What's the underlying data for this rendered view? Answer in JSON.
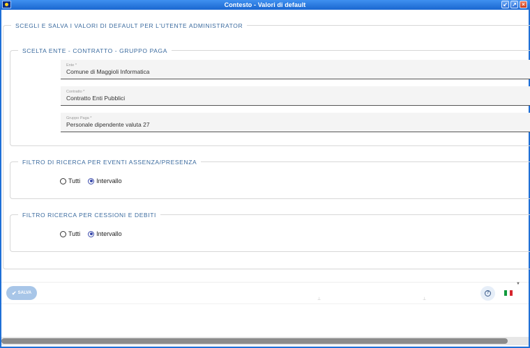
{
  "window": {
    "title": "Contesto - Valori di default",
    "controls": [
      "minimize-icon",
      "maximize-icon",
      "close-icon"
    ]
  },
  "main": {
    "section_title": "SCEGLI E SALVA I VALORI DI DEFAULT PER L'UTENTE ADMINISTRATOR"
  },
  "ente_section": {
    "legend": "SCELTA ENTE - CONTRATTO - GRUPPO PAGA",
    "fields": [
      {
        "label": "Ente *",
        "value": "Comune di Maggioli Informatica"
      },
      {
        "label": "Contratto *",
        "value": "Contratto Enti Pubblici"
      },
      {
        "label": "Gruppo Paga *",
        "value": "Personale dipendente valuta 27"
      }
    ]
  },
  "filtro_eventi": {
    "legend": "FILTRO DI RICERCA PER EVENTI ASSENZA/PRESENZA",
    "options": [
      {
        "label": "Tutti",
        "selected": false
      },
      {
        "label": "Intervallo",
        "selected": true
      }
    ]
  },
  "filtro_cessioni": {
    "legend": "FILTRO RICERCA PER CESSIONI E DEBITI",
    "options": [
      {
        "label": "Tutti",
        "selected": false
      },
      {
        "label": "Intervallo",
        "selected": true
      }
    ]
  },
  "footer": {
    "save_label": "SALVA",
    "help_symbol": "?",
    "language_flag": "it-flag-icon"
  },
  "colors": {
    "title_bar": "#1a66d0",
    "accent_text": "#3a6a9e",
    "save_button": "#a8c6e8",
    "radio_selected": "#3949ab"
  }
}
